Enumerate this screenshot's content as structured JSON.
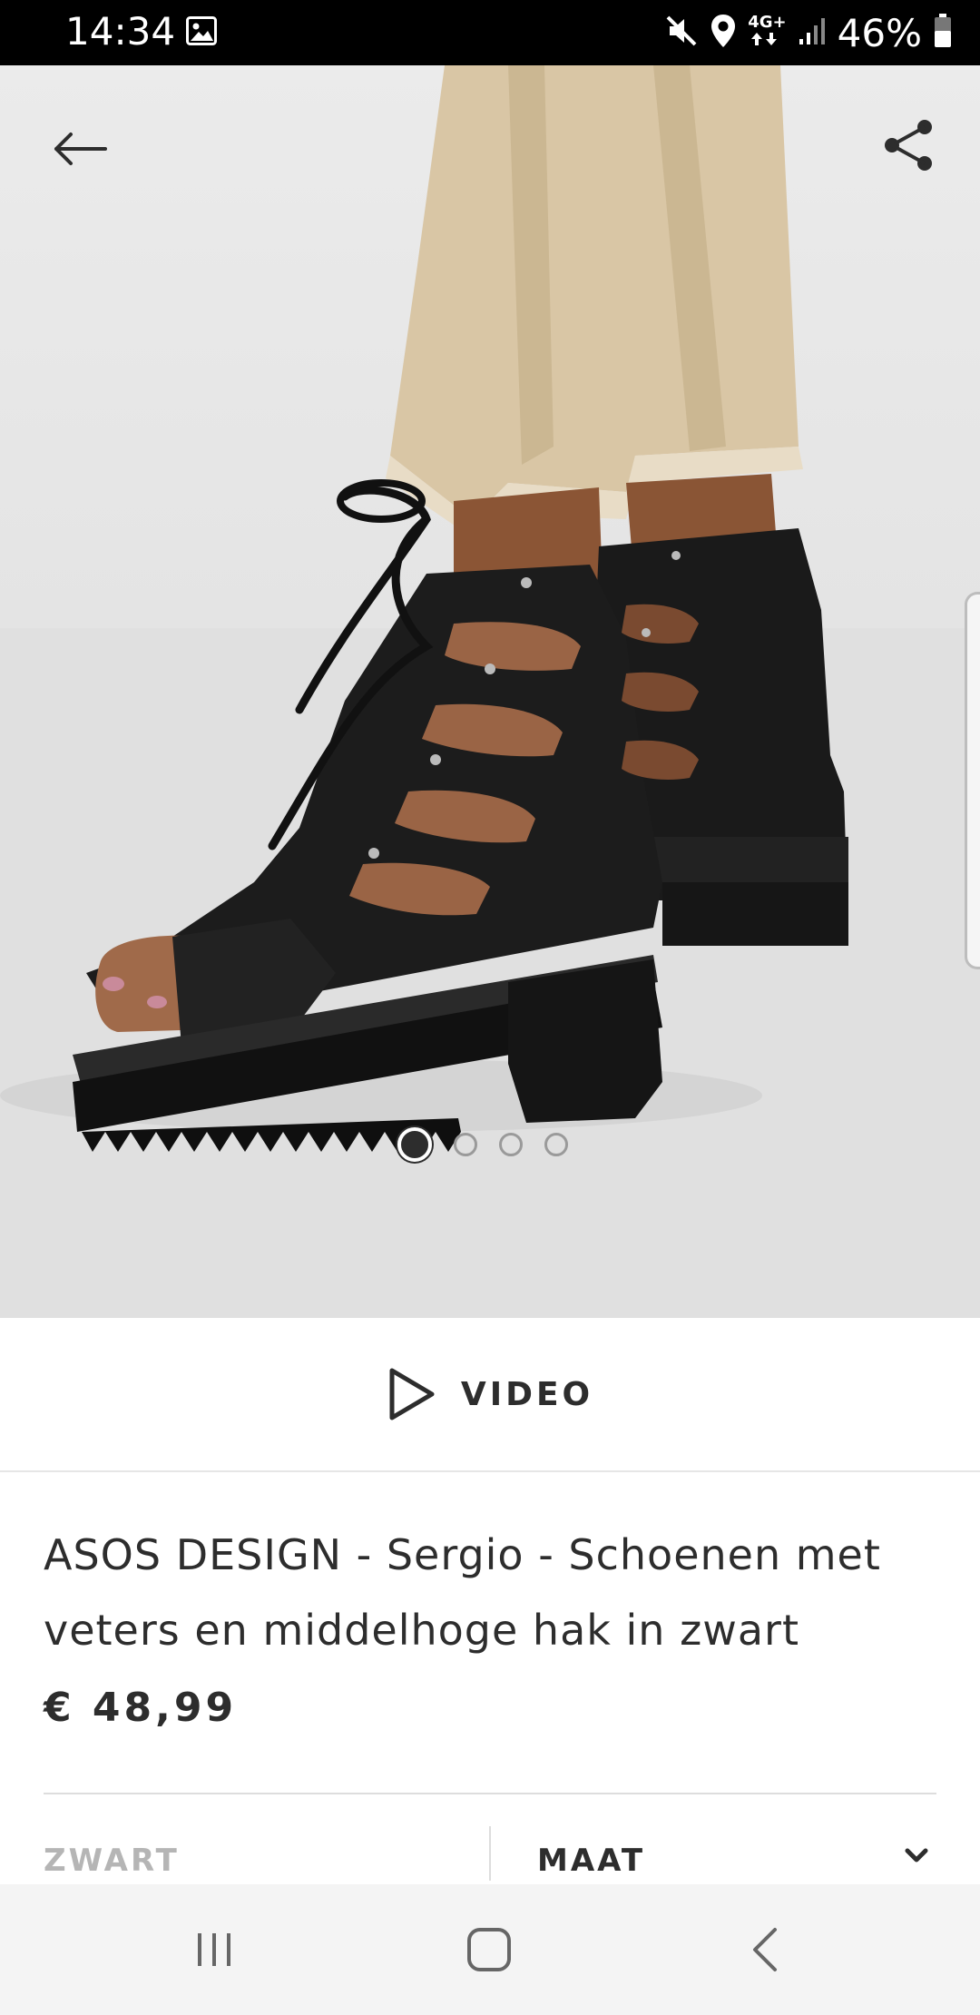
{
  "status_bar": {
    "time": "14:34",
    "network": "4G+",
    "battery": "46%",
    "icons": [
      "gallery-icon",
      "mute-icon",
      "location-icon",
      "network-icon",
      "signal-icon",
      "battery-icon"
    ]
  },
  "gallery": {
    "total_images": 4,
    "active_index": 0,
    "back_icon": "arrow-left-icon",
    "share_icon": "share-icon"
  },
  "video": {
    "label": "VIDEO",
    "icon": "play-icon"
  },
  "product": {
    "title": "ASOS DESIGN - Sergio - Schoenen met veters en middelhoge hak in zwart",
    "price": "€ 48,99"
  },
  "options": {
    "colour_label": "ZWART",
    "size_label": "MAAT",
    "size_icon": "chevron-down-icon"
  },
  "nav_bar": {
    "icons": [
      "recent-apps-icon",
      "home-icon",
      "back-icon"
    ]
  },
  "colors": {
    "text": "#2d2d2d",
    "muted": "#b5b5b5",
    "status_bar": "#000000",
    "nav_bar": "#f4f4f4"
  }
}
